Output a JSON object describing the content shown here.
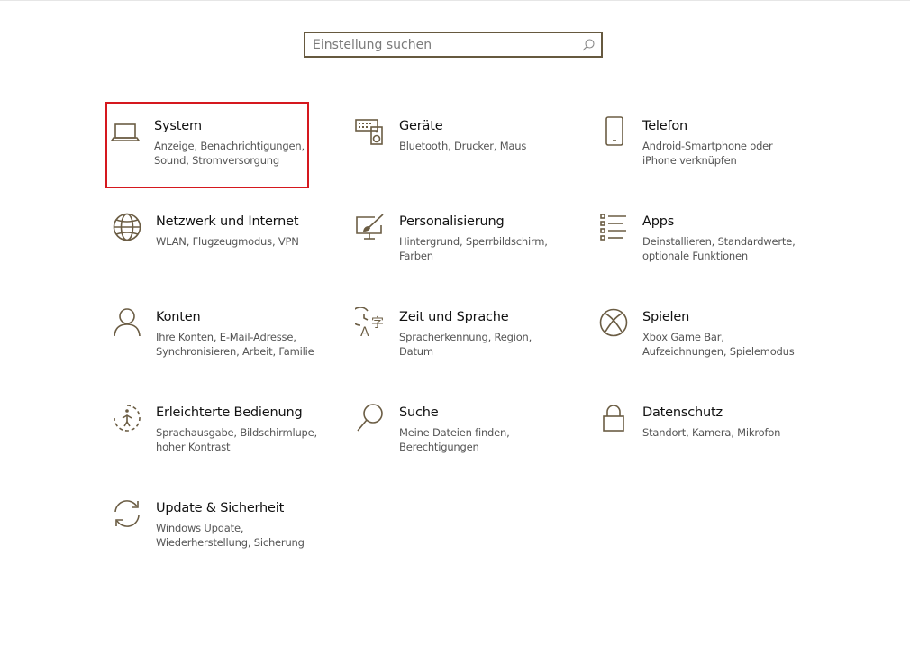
{
  "search": {
    "placeholder": "Einstellung suchen"
  },
  "tiles": [
    {
      "title": "System",
      "desc": "Anzeige, Benachrichtigungen, Sound, Stromversorgung",
      "icon": "laptop-icon"
    },
    {
      "title": "Geräte",
      "desc": "Bluetooth, Drucker, Maus",
      "icon": "keyboard-speaker-icon"
    },
    {
      "title": "Telefon",
      "desc": "Android-Smartphone oder iPhone verknüpfen",
      "icon": "phone-icon"
    },
    {
      "title": "Netzwerk und Internet",
      "desc": "WLAN, Flugzeugmodus, VPN",
      "icon": "globe-icon"
    },
    {
      "title": "Personalisierung",
      "desc": "Hintergrund, Sperrbildschirm, Farben",
      "icon": "paint-brush-icon"
    },
    {
      "title": "Apps",
      "desc": "Deinstallieren, Standardwerte, optionale Funktionen",
      "icon": "app-list-icon"
    },
    {
      "title": "Konten",
      "desc": "Ihre Konten, E-Mail-Adresse, Synchronisieren, Arbeit, Familie",
      "icon": "person-icon"
    },
    {
      "title": "Zeit und Sprache",
      "desc": "Spracherkennung, Region, Datum",
      "icon": "time-language-icon"
    },
    {
      "title": "Spielen",
      "desc": "Xbox Game Bar, Aufzeichnungen, Spielemodus",
      "icon": "xbox-icon"
    },
    {
      "title": "Erleichterte Bedienung",
      "desc": "Sprachausgabe, Bildschirmlupe, hoher Kontrast",
      "icon": "ease-of-access-icon"
    },
    {
      "title": "Suche",
      "desc": "Meine Dateien finden, Berechtigungen",
      "icon": "magnifier-icon"
    },
    {
      "title": "Datenschutz",
      "desc": "Standort, Kamera, Mikrofon",
      "icon": "lock-icon"
    },
    {
      "title": "Update & Sicherheit",
      "desc": "Windows Update, Wiederherstellung, Sicherung",
      "icon": "update-icon"
    }
  ],
  "colors": {
    "icon": "#6b5d44",
    "selection": "#d5181e",
    "search_border": "#66593f"
  }
}
